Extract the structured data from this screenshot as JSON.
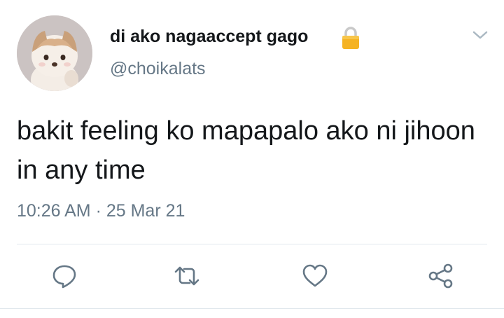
{
  "tweet": {
    "author": {
      "display_name": "di ako nagaaccept gago",
      "handle": "@choikalats",
      "protected_icon": "lock-icon",
      "avatar": "plush-dog-avatar"
    },
    "text": "bakit feeling ko mapapalo ako ni jihoon in any time",
    "timestamp": "10:26 AM · 25 Mar 21",
    "menu_icon": "chevron-down-icon"
  },
  "actions": [
    {
      "name": "reply",
      "icon": "comment-icon"
    },
    {
      "name": "retweet",
      "icon": "retweet-icon"
    },
    {
      "name": "like",
      "icon": "heart-icon"
    },
    {
      "name": "share",
      "icon": "share-icon"
    }
  ],
  "colors": {
    "text_primary": "#14171a",
    "text_secondary": "#657786",
    "icon": "#657786",
    "divider": "#e1e8ed",
    "lock": "#f5b323"
  }
}
